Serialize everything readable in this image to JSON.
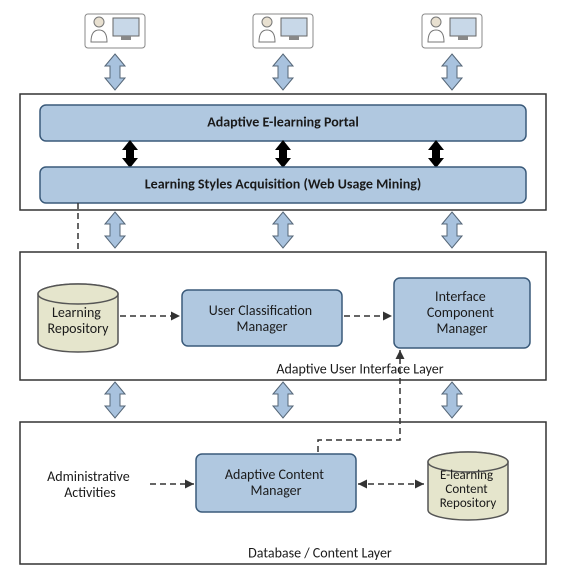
{
  "layers": {
    "top": {
      "portal": "Adaptive E-learning Portal",
      "styles": "Learning Styles Acquisition (Web Usage Mining)"
    },
    "ui": {
      "caption": "Adaptive User Interface Layer",
      "learning_repo": "Learning\nRepository",
      "ucm": "User Classification\nManager",
      "icm": "Interface\nComponent\nManager"
    },
    "content": {
      "caption": "Database / Content Layer",
      "admin": "Administrative\nActivities",
      "acm": "Adaptive Content\nManager",
      "repo": "E-learning\nContent\nRepository"
    }
  }
}
